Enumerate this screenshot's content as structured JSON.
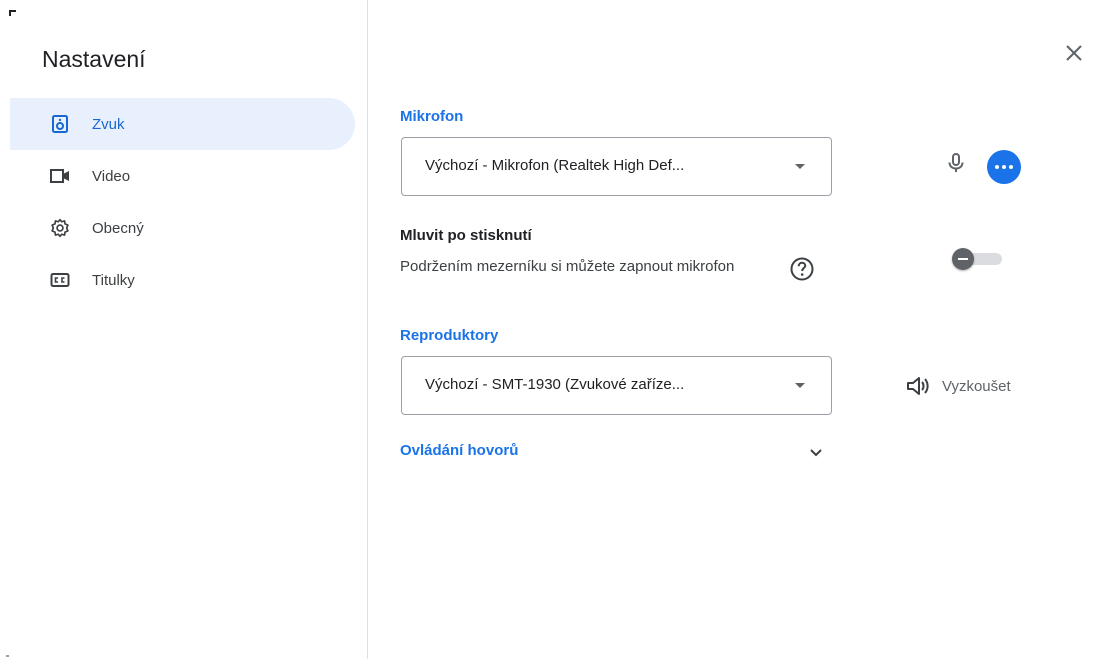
{
  "dialog": {
    "title": "Nastavení",
    "close_icon": "close-icon"
  },
  "sidebar": {
    "items": [
      {
        "label": "Zvuk",
        "icon": "speaker-icon",
        "active": true
      },
      {
        "label": "Video",
        "icon": "videocam-icon",
        "active": false
      },
      {
        "label": "Obecný",
        "icon": "gear-icon",
        "active": false
      },
      {
        "label": "Titulky",
        "icon": "closed-captions-icon",
        "active": false
      }
    ]
  },
  "microphone": {
    "label": "Mikrofon",
    "selected": "Výchozí - Mikrofon (Realtek High Def...",
    "mic_icon": "microphone-icon",
    "more_icon": "more-horiz-icon"
  },
  "push_to_talk": {
    "title": "Mluvit po stisknutí",
    "description": "Podržením mezerníku si můžete zapnout mikrofon",
    "help_icon": "help-icon",
    "enabled": false
  },
  "speakers": {
    "label": "Reproduktory",
    "selected": "Výchozí - SMT-1930 (Zvukové zaříze...",
    "test_label": "Vyzkoušet",
    "test_icon": "volume-icon"
  },
  "call_controls": {
    "label": "Ovládání hovorů",
    "expand_icon": "chevron-down-icon"
  },
  "colors": {
    "accent": "#1a73e8",
    "active_bg": "#e8f0fe",
    "text": "#3c4043"
  }
}
